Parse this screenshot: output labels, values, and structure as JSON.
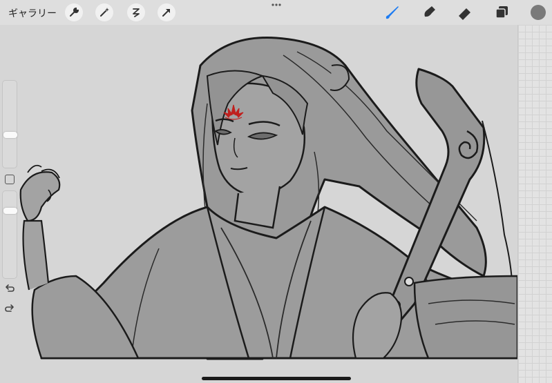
{
  "toolbar": {
    "gallery_label": "ギャラリー",
    "left_tools": [
      "wrench-icon",
      "magic-wand-icon",
      "selection-s-icon",
      "transform-arrow-icon"
    ],
    "right_tools": [
      "brush-icon",
      "smudge-icon",
      "eraser-icon",
      "layers-icon"
    ],
    "active_tool": "brush-icon",
    "active_color": "#7a7a7a",
    "accent": "#1e7cf2"
  },
  "sidebar": {
    "brush_size_level": 0.5,
    "opacity_level": 0.5,
    "buttons": [
      "modify-square-icon",
      "undo-icon",
      "redo-icon"
    ]
  },
  "canvas": {
    "background": "#d6d6d6",
    "artwork": "line-art-sketch"
  }
}
